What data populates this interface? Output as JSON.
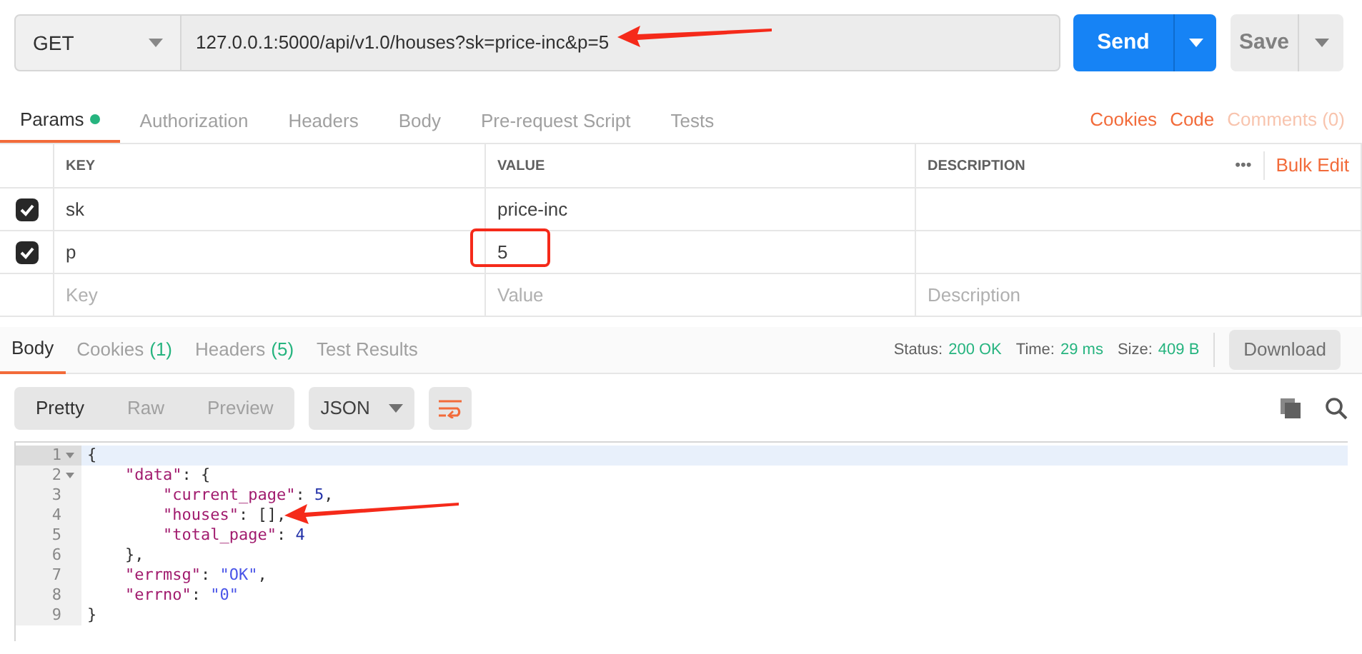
{
  "request": {
    "method": "GET",
    "url": "127.0.0.1:5000/api/v1.0/houses?sk=price-inc&p=5",
    "send": "Send",
    "save": "Save"
  },
  "request_tabs": [
    {
      "label": "Params",
      "selected": true,
      "dot": true
    },
    {
      "label": "Authorization",
      "selected": false,
      "dot": false
    },
    {
      "label": "Headers",
      "selected": false,
      "dot": false
    },
    {
      "label": "Body",
      "selected": false,
      "dot": false
    },
    {
      "label": "Pre-request Script",
      "selected": false,
      "dot": false
    },
    {
      "label": "Tests",
      "selected": false,
      "dot": false
    }
  ],
  "request_links": [
    {
      "label": "Cookies",
      "disabled": false
    },
    {
      "label": "Code",
      "disabled": false
    },
    {
      "label": "Comments (0)",
      "disabled": true
    }
  ],
  "params": {
    "columns": [
      "KEY",
      "VALUE",
      "DESCRIPTION"
    ],
    "more": "•••",
    "bulk_edit": "Bulk Edit",
    "rows": [
      {
        "checked": true,
        "key": "sk",
        "value": "price-inc"
      },
      {
        "checked": true,
        "key": "p",
        "value": "5"
      }
    ],
    "new_row": [
      {
        "placeholder": "Key"
      },
      {
        "placeholder": "Value"
      },
      {
        "placeholder": "Description"
      }
    ]
  },
  "response_tabs": [
    {
      "label": "Body",
      "selected": true
    },
    {
      "label": "Cookies",
      "count": "(1)",
      "selected": false
    },
    {
      "label": "Headers",
      "count": "(5)",
      "selected": false
    },
    {
      "label": "Test Results",
      "selected": false
    }
  ],
  "status": [
    {
      "label": "Status:",
      "value": "200 OK"
    },
    {
      "label": "Time:",
      "value": "29 ms"
    },
    {
      "label": "Size:",
      "value": "409 B"
    }
  ],
  "download": "Download",
  "view_modes": [
    {
      "label": "Pretty",
      "selected": true
    },
    {
      "label": "Raw",
      "selected": false
    },
    {
      "label": "Preview",
      "selected": false
    }
  ],
  "format": "JSON",
  "code": [
    {
      "number": "1",
      "fold": true,
      "active": true,
      "tokens": [
        {
          "kind": "punct",
          "text": "{"
        }
      ]
    },
    {
      "number": "2",
      "fold": true,
      "active": false,
      "tokens": [
        {
          "kind": "key",
          "text": "    \"data\""
        },
        {
          "kind": "punct",
          "text": ": {"
        }
      ]
    },
    {
      "number": "3",
      "fold": false,
      "active": false,
      "tokens": [
        {
          "kind": "key",
          "text": "        \"current_page\""
        },
        {
          "kind": "punct",
          "text": ": "
        },
        {
          "kind": "number",
          "text": "5"
        },
        {
          "kind": "punct",
          "text": ","
        }
      ]
    },
    {
      "number": "4",
      "fold": false,
      "active": false,
      "tokens": [
        {
          "kind": "key",
          "text": "        \"houses\""
        },
        {
          "kind": "punct",
          "text": ": [],"
        }
      ]
    },
    {
      "number": "5",
      "fold": false,
      "active": false,
      "tokens": [
        {
          "kind": "key",
          "text": "        \"total_page\""
        },
        {
          "kind": "punct",
          "text": ": "
        },
        {
          "kind": "number",
          "text": "4"
        }
      ]
    },
    {
      "number": "6",
      "fold": false,
      "active": false,
      "tokens": [
        {
          "kind": "punct",
          "text": "    },"
        }
      ]
    },
    {
      "number": "7",
      "fold": false,
      "active": false,
      "tokens": [
        {
          "kind": "key",
          "text": "    \"errmsg\""
        },
        {
          "kind": "punct",
          "text": ": "
        },
        {
          "kind": "string",
          "text": "\"OK\""
        },
        {
          "kind": "punct",
          "text": ","
        }
      ]
    },
    {
      "number": "8",
      "fold": false,
      "active": false,
      "tokens": [
        {
          "kind": "key",
          "text": "    \"errno\""
        },
        {
          "kind": "punct",
          "text": ": "
        },
        {
          "kind": "string",
          "text": "\"0\""
        }
      ]
    },
    {
      "number": "9",
      "fold": false,
      "active": false,
      "tokens": [
        {
          "kind": "punct",
          "text": "}"
        }
      ]
    }
  ]
}
